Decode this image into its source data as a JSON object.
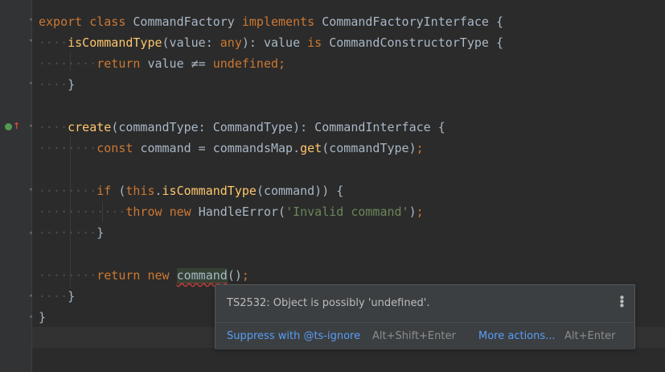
{
  "editor": {
    "lines": [
      {
        "parts": [
          {
            "t": "export ",
            "c": "kw"
          },
          {
            "t": "class ",
            "c": "kw"
          },
          {
            "t": "CommandFactory ",
            "c": "ty"
          },
          {
            "t": "implements ",
            "c": "kw"
          },
          {
            "t": "CommandFactoryInterface {",
            "c": "ty"
          }
        ]
      },
      {
        "parts": [
          {
            "t": "isCommandType",
            "c": "fn"
          },
          {
            "t": "(value: ",
            "c": "ty"
          },
          {
            "t": "any",
            "c": "kw"
          },
          {
            "t": "): value ",
            "c": "ty"
          },
          {
            "t": "is ",
            "c": "kw"
          },
          {
            "t": "CommandConstructorType {",
            "c": "ty"
          }
        ]
      },
      {
        "parts": [
          {
            "t": "return ",
            "c": "kw"
          },
          {
            "t": "value ≠= ",
            "c": "ty"
          },
          {
            "t": "undefined",
            "c": "kw"
          },
          {
            "t": ";",
            "c": "kw"
          }
        ]
      },
      {
        "parts": [
          {
            "t": "}",
            "c": "ty"
          }
        ]
      },
      {
        "parts": []
      },
      {
        "parts": [
          {
            "t": "create",
            "c": "fn"
          },
          {
            "t": "(commandType: CommandType): CommandInterface {",
            "c": "ty"
          }
        ]
      },
      {
        "parts": [
          {
            "t": "const ",
            "c": "kw"
          },
          {
            "t": "command = commandsMap.",
            "c": "ty"
          },
          {
            "t": "get",
            "c": "fn"
          },
          {
            "t": "(commandType)",
            "c": "ty"
          },
          {
            "t": ";",
            "c": "kw"
          }
        ]
      },
      {
        "parts": []
      },
      {
        "parts": [
          {
            "t": "if ",
            "c": "kw"
          },
          {
            "t": "(",
            "c": "ty"
          },
          {
            "t": "this",
            "c": "kw"
          },
          {
            "t": ".",
            "c": "ty"
          },
          {
            "t": "isCommandType",
            "c": "fn"
          },
          {
            "t": "(command)) {",
            "c": "ty"
          }
        ]
      },
      {
        "parts": [
          {
            "t": "throw ",
            "c": "kw"
          },
          {
            "t": "new ",
            "c": "kw"
          },
          {
            "t": "HandleError(",
            "c": "ty"
          },
          {
            "t": "'Invalid command'",
            "c": "str"
          },
          {
            "t": ")",
            "c": "ty"
          },
          {
            "t": ";",
            "c": "kw"
          }
        ]
      },
      {
        "parts": [
          {
            "t": "}",
            "c": "ty"
          }
        ]
      },
      {
        "parts": []
      },
      {
        "parts": [
          {
            "t": "return ",
            "c": "kw"
          },
          {
            "t": "new ",
            "c": "kw"
          },
          {
            "t": "command",
            "c": "err"
          },
          {
            "t": "()",
            "c": "ty"
          },
          {
            "t": ";",
            "c": "kw"
          }
        ]
      },
      {
        "parts": [
          {
            "t": "}",
            "c": "ty"
          }
        ]
      },
      {
        "parts": [
          {
            "t": "}",
            "c": "ty"
          }
        ]
      }
    ]
  },
  "tooltip": {
    "message": "TS2532: Object is possibly 'undefined'.",
    "suppress_label": "Suppress with @ts-ignore",
    "suppress_shortcut": "Alt+Shift+Enter",
    "more_label": "More actions...",
    "more_shortcut": "Alt+Enter",
    "menu_icon": "more-vertical-icon"
  },
  "gutter": {
    "marker_icon": "implements-method-icon"
  },
  "colors": {
    "background": "#2b2b2b",
    "keyword": "#cc7832",
    "function": "#ffc66d",
    "string": "#6a8759",
    "text": "#a9b7c6",
    "link": "#589df6",
    "error_underline": "#bc3f3c"
  }
}
